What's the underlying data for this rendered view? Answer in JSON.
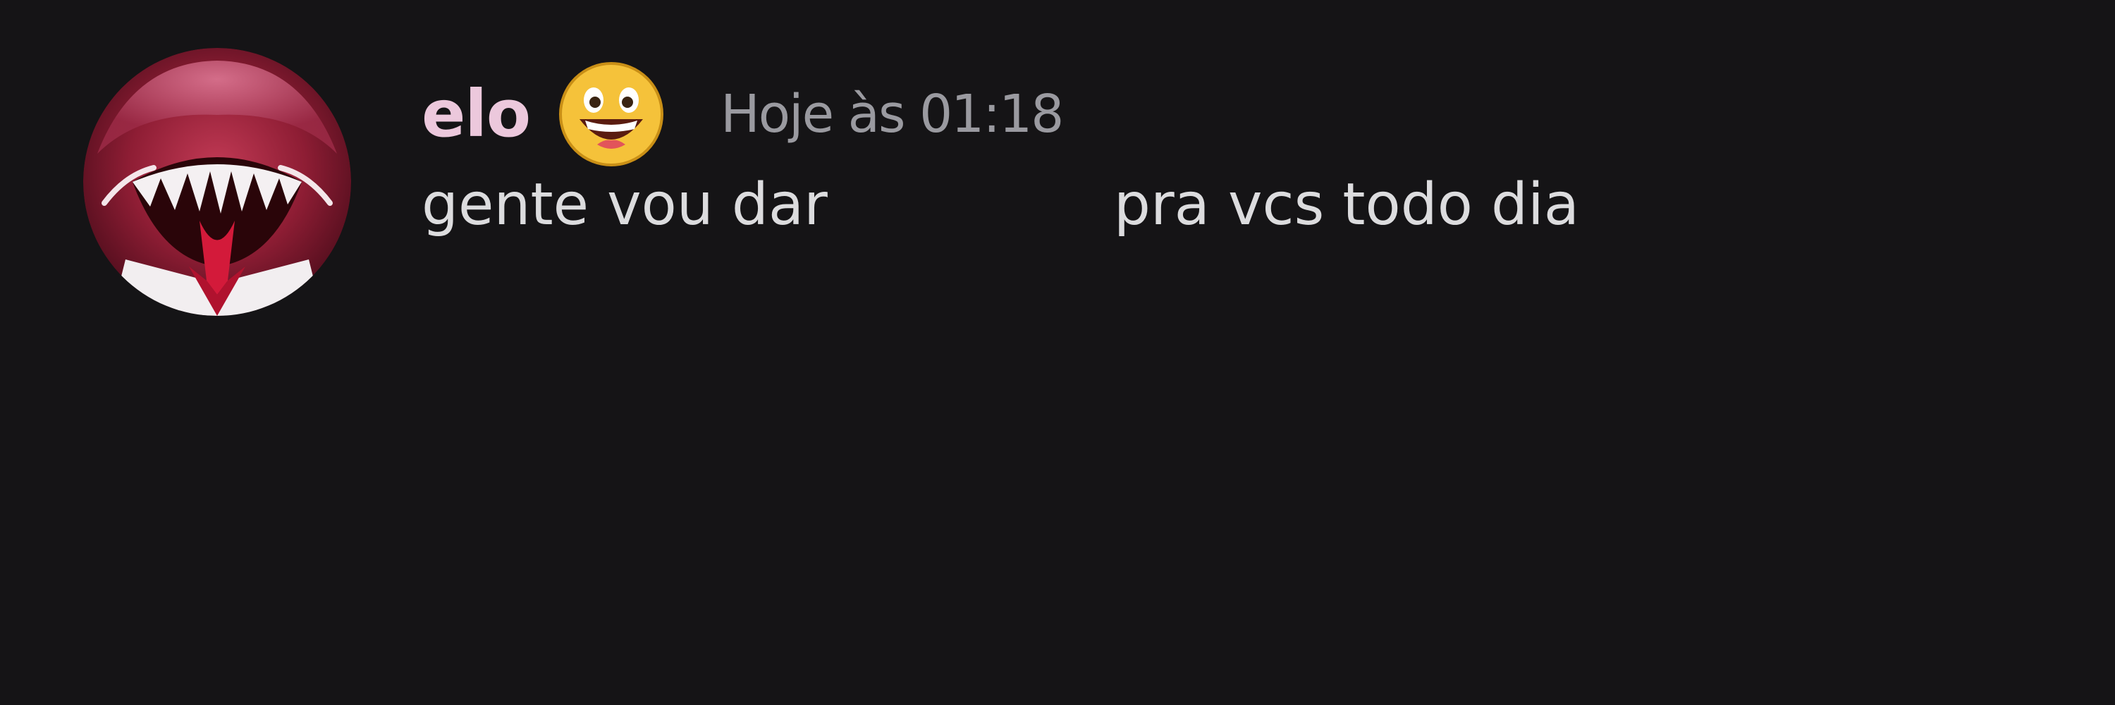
{
  "message": {
    "author": "elo",
    "badge_icon": "grinning-face-icon",
    "timestamp": "Hoje às 01:18",
    "content_part1": "gente vou dar",
    "content_part2": "pra vcs todo dia"
  },
  "colors": {
    "background": "#151416",
    "username": "#ecc8dc",
    "timestamp": "#9a9aa0",
    "message_text": "#dcdcde",
    "avatar_red": "#a8203a"
  }
}
